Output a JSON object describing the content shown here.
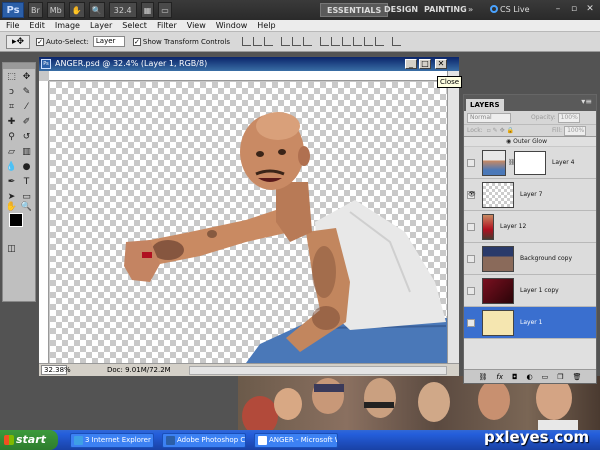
{
  "appbar": {
    "logo": "Ps",
    "zoom": "32.4",
    "workspaces": [
      "ESSENTIALS",
      "DESIGN",
      "PAINTING",
      "»"
    ],
    "cslive": "CS Live"
  },
  "menubar": [
    "File",
    "Edit",
    "Image",
    "Layer",
    "Select",
    "Filter",
    "View",
    "Window",
    "Help"
  ],
  "options": {
    "auto_select_label": "Auto-Select:",
    "auto_select_value": "Layer",
    "show_transform_label": "Show Transform Controls"
  },
  "document": {
    "title": "ANGER.psd @ 32.4% (Layer 1, RGB/8)",
    "zoom_field": "32.38%",
    "doc_size": "Doc: 9.01M/72.2M",
    "close_tooltip": "Close"
  },
  "layers_panel": {
    "tab": "LAYERS",
    "blend_mode": "Normal",
    "opacity_label": "Opacity:",
    "opacity_value": "100%",
    "lock_label": "Lock:",
    "fill_label": "Fill:",
    "fill_value": "100%",
    "effect": "Outer Glow",
    "layers": [
      {
        "name": "Layer 4",
        "selected": false
      },
      {
        "name": "Layer 7",
        "selected": false
      },
      {
        "name": "Layer 12",
        "selected": false
      },
      {
        "name": "Background copy",
        "selected": false
      },
      {
        "name": "Layer 1 copy",
        "selected": false
      },
      {
        "name": "Layer 1",
        "selected": true
      }
    ]
  },
  "taskbar": {
    "start": "start",
    "tasks": [
      "3 Internet Explorer",
      "Adobe Photoshop CS5",
      "ANGER - Microsoft W..."
    ]
  },
  "watermark": "pxleyes.com",
  "colors": {
    "foreground": "#000000",
    "background": "#ffffff",
    "selected_layer": "#3a6fcf"
  }
}
